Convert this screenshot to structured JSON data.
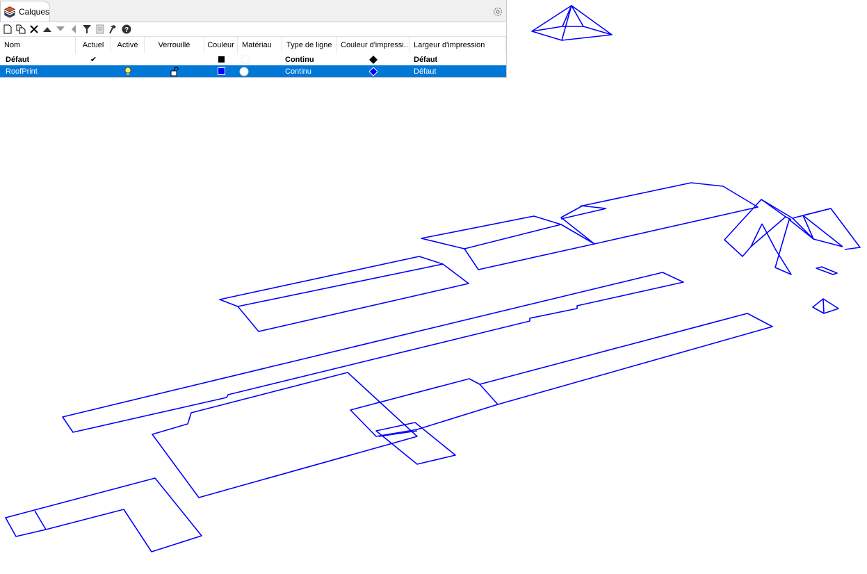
{
  "panel": {
    "tab_label": "Calques",
    "settings_icon": "gear-icon"
  },
  "toolbar": {
    "buttons": [
      {
        "name": "new-layer-button",
        "icon": "new-document-icon"
      },
      {
        "name": "new-sublayer-button",
        "icon": "copy-document-icon"
      },
      {
        "name": "delete-layer-button",
        "icon": "close-icon"
      },
      {
        "name": "move-up-button",
        "icon": "triangle-up-icon"
      },
      {
        "name": "move-down-button",
        "icon": "triangle-down-icon"
      },
      {
        "name": "move-out-button",
        "icon": "triangle-left-icon"
      },
      {
        "name": "filter-button",
        "icon": "filter-icon"
      },
      {
        "name": "tools-button",
        "icon": "layer-tools-icon"
      },
      {
        "name": "hammer-button",
        "icon": "hammer-icon"
      },
      {
        "name": "help-button",
        "icon": "help-icon"
      }
    ]
  },
  "table": {
    "headers": {
      "name": "Nom",
      "current": "Actuel",
      "on": "Activé",
      "locked": "Verrouillé",
      "color": "Couleur",
      "material": "Matériau",
      "linetype": "Type de ligne",
      "print_color": "Couleur d'impressi...",
      "print_width": "Largeur d'impression"
    },
    "rows": [
      {
        "name": "Défaut",
        "current": "✔",
        "linetype": "Continu",
        "print_width": "Défaut",
        "color": "#000000",
        "print_color": "#000000",
        "selected": false
      },
      {
        "name": "RoofPrint",
        "linetype": "Continu",
        "print_width": "Défaut",
        "color": "#0000ff",
        "print_color": "#0000ff",
        "selected": true
      }
    ]
  },
  "scene": {
    "stroke_color": "#0000ff",
    "background": "#ffffff"
  }
}
